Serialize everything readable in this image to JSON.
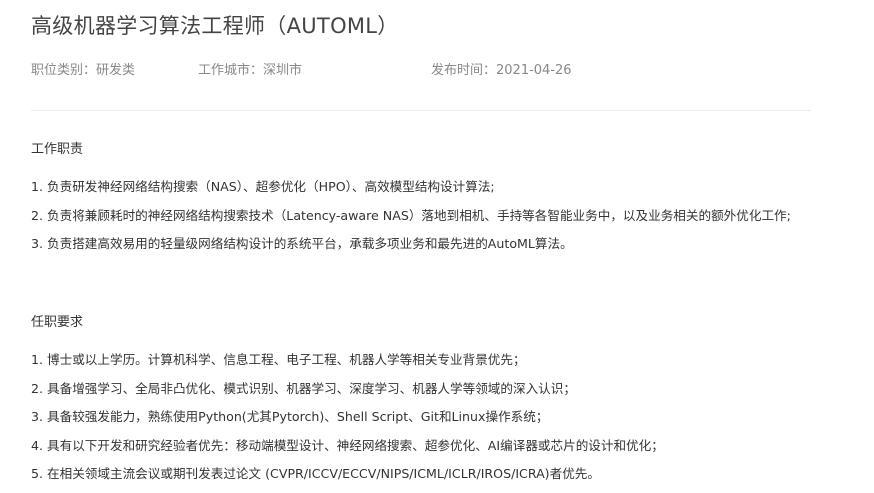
{
  "job": {
    "title": "高级机器学习算法工程师（AUTOML）",
    "category": "职位类别：研发类",
    "city": "工作城市：深圳市",
    "date": "发布时间：2021-04-26"
  },
  "duties": {
    "heading": "工作职责",
    "items": [
      "1. 负责研发神经网络结构搜索（NAS）、超参优化（HPO）、高效模型结构设计算法;",
      "2. 负责将兼顾耗时的神经网络结构搜索技术（Latency-aware NAS）落地到相机、手持等各智能业务中，以及业务相关的额外优化工作;",
      "3. 负责搭建高效易用的轻量级网络结构设计的系统平台，承载多项业务和最先进的AutoML算法。"
    ]
  },
  "requirements": {
    "heading": "任职要求",
    "items": [
      "1. 博士或以上学历。计算机科学、信息工程、电子工程、机器人学等相关专业背景优先；",
      "2. 具备增强学习、全局非凸优化、模式识别、机器学习、深度学习、机器人学等领域的深入认识；",
      "3. 具备较强发能力，熟练使用Python(尤其Pytorch)、Shell Script、Git和Linux操作系统；",
      "4. 具有以下开发和研究经验者优先：移动端模型设计、神经网络搜索、超参优化、AI编译器或芯片的设计和优化；",
      "5. 在相关领域主流会议或期刊发表过论文 (CVPR/ICCV/ECCV/NIPS/ICML/ICLR/IROS/ICRA)者优先。"
    ]
  }
}
